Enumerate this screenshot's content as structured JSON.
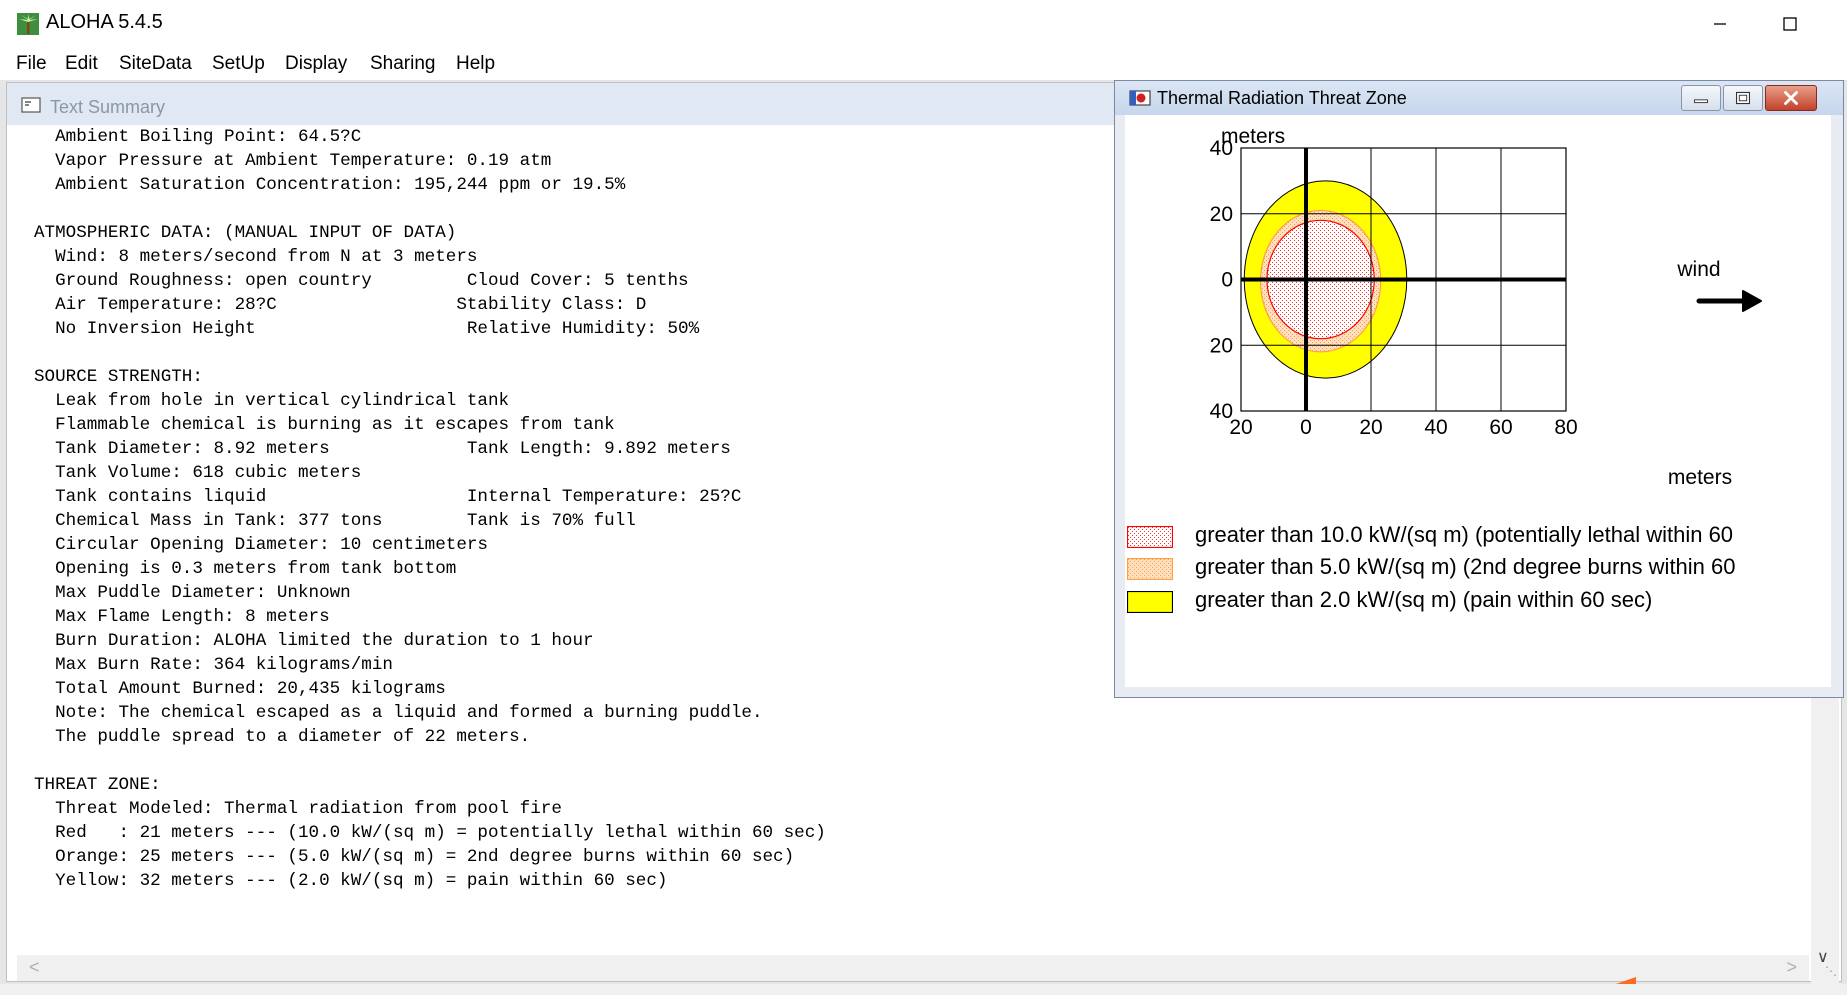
{
  "app": {
    "title": "ALOHA 5.4.5",
    "menu": [
      "File",
      "Edit",
      "SiteData",
      "SetUp",
      "Display",
      "Sharing",
      "Help"
    ]
  },
  "text_summary": {
    "title": "Text Summary",
    "lines": [
      "  Ambient Boiling Point: 64.5?C",
      "  Vapor Pressure at Ambient Temperature: 0.19 atm",
      "  Ambient Saturation Concentration: 195,244 ppm or 19.5%",
      "",
      "ATMOSPHERIC DATA: (MANUAL INPUT OF DATA)",
      "  Wind: 8 meters/second from N at 3 meters",
      "  Ground Roughness: open country         Cloud Cover: 5 tenths",
      "  Air Temperature: 28?C                 Stability Class: D",
      "  No Inversion Height                    Relative Humidity: 50%",
      "",
      "SOURCE STRENGTH:",
      "  Leak from hole in vertical cylindrical tank",
      "  Flammable chemical is burning as it escapes from tank",
      "  Tank Diameter: 8.92 meters             Tank Length: 9.892 meters",
      "  Tank Volume: 618 cubic meters",
      "  Tank contains liquid                   Internal Temperature: 25?C",
      "  Chemical Mass in Tank: 377 tons        Tank is 70% full",
      "  Circular Opening Diameter: 10 centimeters",
      "  Opening is 0.3 meters from tank bottom",
      "  Max Puddle Diameter: Unknown",
      "  Max Flame Length: 8 meters",
      "  Burn Duration: ALOHA limited the duration to 1 hour",
      "  Max Burn Rate: 364 kilograms/min",
      "  Total Amount Burned: 20,435 kilograms",
      "  Note: The chemical escaped as a liquid and formed a burning puddle.",
      "  The puddle spread to a diameter of 22 meters.",
      "",
      "THREAT ZONE:",
      "  Threat Modeled: Thermal radiation from pool fire",
      "  Red   : 21 meters --- (10.0 kW/(sq m) = potentially lethal within 60 sec)",
      "  Orange: 25 meters --- (5.0 kW/(sq m) = 2nd degree burns within 60 sec)",
      "  Yellow: 32 meters --- (2.0 kW/(sq m) = pain within 60 sec)"
    ]
  },
  "threat_zone": {
    "title": "Thermal Radiation Threat Zone",
    "y_unit": "meters",
    "x_unit": "meters",
    "y_ticks": [
      "40",
      "20",
      "0",
      "20",
      "40"
    ],
    "x_ticks": [
      "20",
      "0",
      "20",
      "40",
      "60",
      "80"
    ],
    "wind_label": "wind",
    "zones": [
      {
        "color": "red",
        "fill": "#ffffff",
        "border": "#ff0000",
        "dot": "#ff3030",
        "radius_m": 21,
        "extent_x_m": [
          -12,
          21
        ],
        "extent_y_m": [
          -18,
          18
        ]
      },
      {
        "color": "orange",
        "fill": "#ffd9b0",
        "border": "#ffa040",
        "dot": "#ff9a40",
        "radius_m": 25,
        "extent_x_m": [
          -14,
          23
        ],
        "extent_y_m": [
          -22,
          21
        ]
      },
      {
        "color": "yellow",
        "fill": "#ffff00",
        "border": "#000000",
        "dot": "",
        "radius_m": 32,
        "extent_x_m": [
          -19,
          31
        ],
        "extent_y_m": [
          -30,
          30
        ]
      }
    ],
    "legend": [
      {
        "text": "greater than 10.0 kW/(sq m) (potentially lethal within 60",
        "swatch": "red"
      },
      {
        "text": "greater than 5.0 kW/(sq m) (2nd degree burns within 60",
        "swatch": "orange"
      },
      {
        "text": "greater than 2.0 kW/(sq m) (pain within 60 sec)",
        "swatch": "yellow"
      }
    ]
  }
}
